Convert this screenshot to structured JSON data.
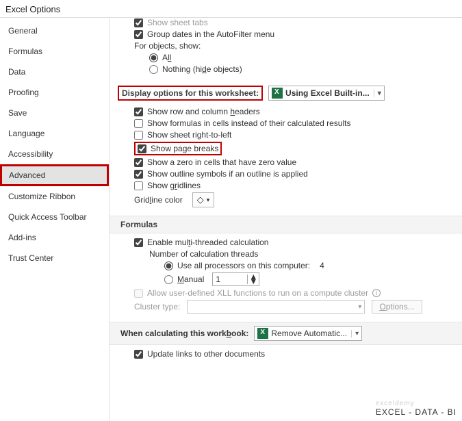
{
  "title": "Excel Options",
  "sidebar": {
    "items": [
      {
        "label": "General"
      },
      {
        "label": "Formulas"
      },
      {
        "label": "Data"
      },
      {
        "label": "Proofing"
      },
      {
        "label": "Save"
      },
      {
        "label": "Language"
      },
      {
        "label": "Accessibility"
      },
      {
        "label": "Advanced"
      },
      {
        "label": "Customize Ribbon"
      },
      {
        "label": "Quick Access Toolbar"
      },
      {
        "label": "Add-ins"
      },
      {
        "label": "Trust Center"
      }
    ]
  },
  "top": {
    "show_sheet_tabs": "Show sheet tabs",
    "group_dates": "Group dates in the AutoFilter menu",
    "for_objects": "For objects, show:",
    "all_pre": "A",
    "all_u": "ll",
    "nothing_pre": "Nothing (hi",
    "nothing_u": "d",
    "nothing_post": "e objects)"
  },
  "disp": {
    "heading": "Display options for this worksheet:",
    "combo": "Using Excel Built-in...",
    "row_col_pre": "Show row and column ",
    "row_col_u": "h",
    "row_col_post": "eaders",
    "formulas": "Show formulas in cells instead of their calculated results",
    "rtl": "Show sheet right-to-left",
    "page_breaks": "Show page breaks",
    "zero": "Show a zero in cells that have zero value",
    "outline": "Show outline symbols if an outline is applied",
    "gridlines_pre": "Show g",
    "gridlines_u": "r",
    "gridlines_post": "idlines",
    "gcolor_pre": "Grid",
    "gcolor_u": "l",
    "gcolor_post": "ine color"
  },
  "formulas": {
    "heading": "Formulas",
    "enable_pre": "Enable mul",
    "enable_u": "t",
    "enable_post": "i-threaded calculation",
    "num_threads": "Number of calculation threads",
    "all_proc": "Use all processors on this computer:",
    "proc_count": "4",
    "manual_u": "M",
    "manual_post": "anual",
    "manual_value": "1",
    "xll": "Allow user-defined XLL functions to run on a compute cluster",
    "cluster": "Cluster type:",
    "options_btn_pre": "O",
    "options_btn_post": "ptions..."
  },
  "calc": {
    "heading_pre": "When calculating this work",
    "heading_u": "b",
    "heading_post": "ook:",
    "combo": "Remove Automatic...",
    "update": "Update links to other documents"
  },
  "watermark": "EXCEL - DATA - BI"
}
